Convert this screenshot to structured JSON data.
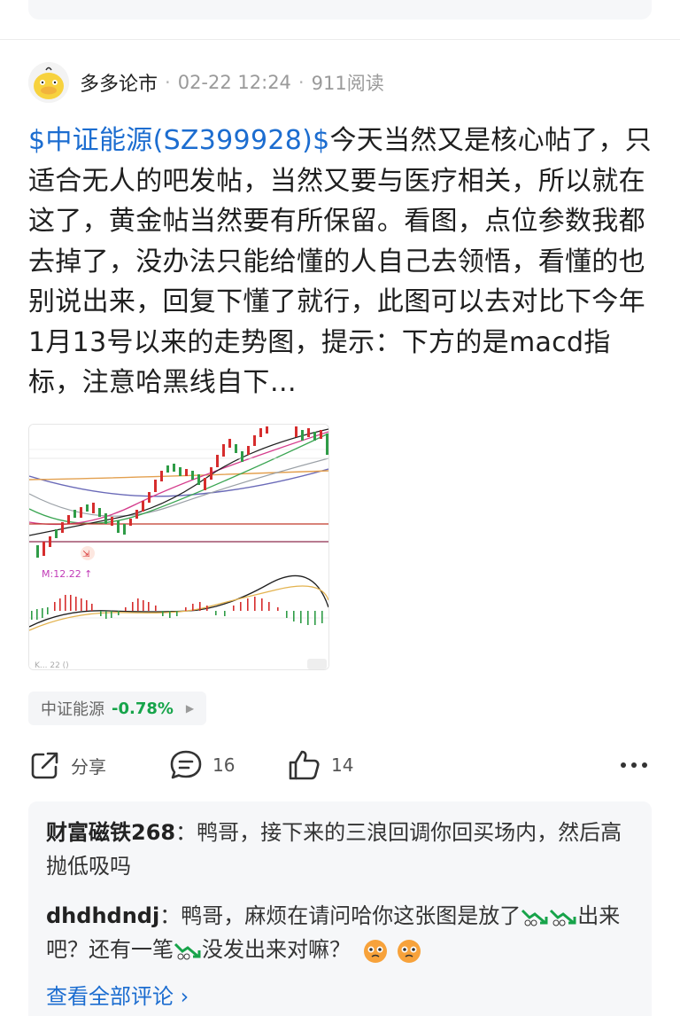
{
  "post": {
    "author": "多多论市",
    "date": "02-22 12:24",
    "reads": "911阅读",
    "stock_link": "$中证能源(SZ399928)$",
    "text": "今天当然又是核心帖了，只适合无人的吧发帖，当然又要与医疗相关，所以就在这了，黄金帖当然要有所保留。看图，点位参数我都去掉了，没办法只能给懂的人自己去领悟，看懂的也别说出来，回复下懂了就行，此图可以去对比下今年1月13号以来的走势图，提示：下方的是macd指标，注意哈黑线自下…"
  },
  "chart": {
    "marker_label": "M:12.22 ↑",
    "bottom_label": "K... 22 ()"
  },
  "stock_tag": {
    "name": "中证能源",
    "change": "-0.78%"
  },
  "actions": {
    "share_label": "分享",
    "comment_count": "16",
    "like_count": "14"
  },
  "comments": [
    {
      "user": "财富磁铁268",
      "text": "：鸭哥，接下来的三浪回调你回买场内，然后高抛低吸吗"
    },
    {
      "user": "dhdhdndj",
      "text_a": "：鸭哥，麻烦在请问哈你这张图是放了",
      "text_b": "出来吧？还有一笔",
      "text_c": "没发出来对嘛？"
    }
  ],
  "view_all": "查看全部评论 ›",
  "colors": {
    "link": "#1c6dd0",
    "down": "#16a44a",
    "up": "#d62d2d"
  }
}
